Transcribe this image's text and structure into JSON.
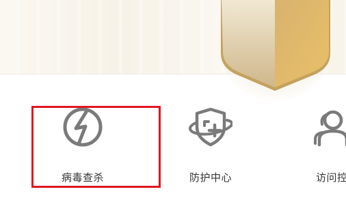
{
  "features": [
    {
      "id": "virus-scan",
      "label": "病毒查杀",
      "icon": "lightning-circle-icon"
    },
    {
      "id": "protection-center",
      "label": "防护中心",
      "icon": "shield-plus-orbit-icon"
    },
    {
      "id": "access-control",
      "label": "访问控",
      "icon": "users-icon"
    }
  ],
  "colors": {
    "highlight_border": "#e0161f",
    "icon_gray": "#7a7a7a",
    "label_text": "#333333",
    "shield_gold_light": "#eadbb8",
    "shield_gold_dark": "#d4a855",
    "hero_background": "#f8f4ea"
  }
}
